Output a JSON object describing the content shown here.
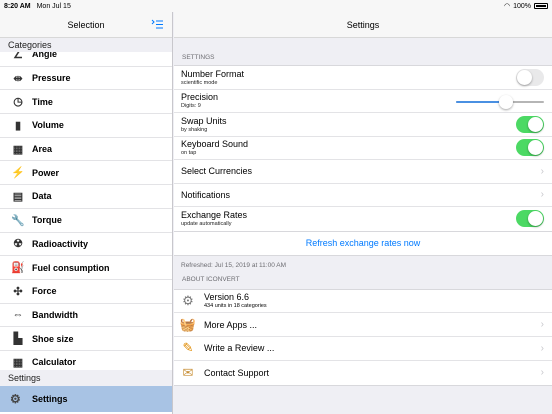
{
  "status": {
    "time": "8:20 AM",
    "date": "Mon Jul 15",
    "battery": "100%"
  },
  "sidebar": {
    "title": "Selection",
    "categories_label": "Categories",
    "items": [
      {
        "label": "Angle",
        "icon": "angle-icon",
        "glyph": "∠"
      },
      {
        "label": "Pressure",
        "icon": "pressure-icon",
        "glyph": "⇹"
      },
      {
        "label": "Time",
        "icon": "clock-icon",
        "glyph": "◷"
      },
      {
        "label": "Volume",
        "icon": "volume-icon",
        "glyph": "▮"
      },
      {
        "label": "Area",
        "icon": "area-grid-icon",
        "glyph": "▦"
      },
      {
        "label": "Power",
        "icon": "power-bolt-icon",
        "glyph": "⚡"
      },
      {
        "label": "Data",
        "icon": "data-tray-icon",
        "glyph": "▤"
      },
      {
        "label": "Torque",
        "icon": "wrench-icon",
        "glyph": "🔧"
      },
      {
        "label": "Radioactivity",
        "icon": "radioactive-icon",
        "glyph": "☢"
      },
      {
        "label": "Fuel consumption",
        "icon": "fuel-pump-icon",
        "glyph": "⛽"
      },
      {
        "label": "Force",
        "icon": "force-arrows-icon",
        "glyph": "✣"
      },
      {
        "label": "Bandwidth",
        "icon": "bandwidth-arrows-icon",
        "glyph": "⇔"
      },
      {
        "label": "Shoe size",
        "icon": "shoe-icon",
        "glyph": "▙"
      },
      {
        "label": "Calculator",
        "icon": "calculator-icon",
        "glyph": "▦"
      }
    ],
    "settings_label": "Settings",
    "settings_item": {
      "label": "Settings",
      "icon": "gear-icon"
    }
  },
  "main": {
    "title": "Settings",
    "settings_header": "SETTINGS",
    "number_format": {
      "title": "Number Format",
      "sub": "scientific mode",
      "on": false
    },
    "precision": {
      "title": "Precision",
      "sub": "Digits: 9",
      "value_fraction": 0.57
    },
    "swap_units": {
      "title": "Swap Units",
      "sub": "by shaking",
      "on": true
    },
    "keyboard_sound": {
      "title": "Keyboard Sound",
      "sub": "on tap",
      "on": true
    },
    "select_currencies": "Select Currencies",
    "notifications": "Notifications",
    "exchange_rates": {
      "title": "Exchange Rates",
      "sub": "update automatically",
      "on": true
    },
    "refresh_link": "Refresh exchange rates now",
    "refreshed": "Refreshed: Jul 15, 2019 at 11:00 AM",
    "about_header": "ABOUT ICONVERT",
    "version": {
      "title": "Version 6.6",
      "sub": "434 units in 18 categories"
    },
    "more_apps": "More Apps ...",
    "write_review": "Write a Review ...",
    "contact_support": "Contact Support"
  },
  "colors": {
    "accent": "#007aff",
    "toggle_on": "#4cd964",
    "selected_row": "#a8c3e4"
  }
}
